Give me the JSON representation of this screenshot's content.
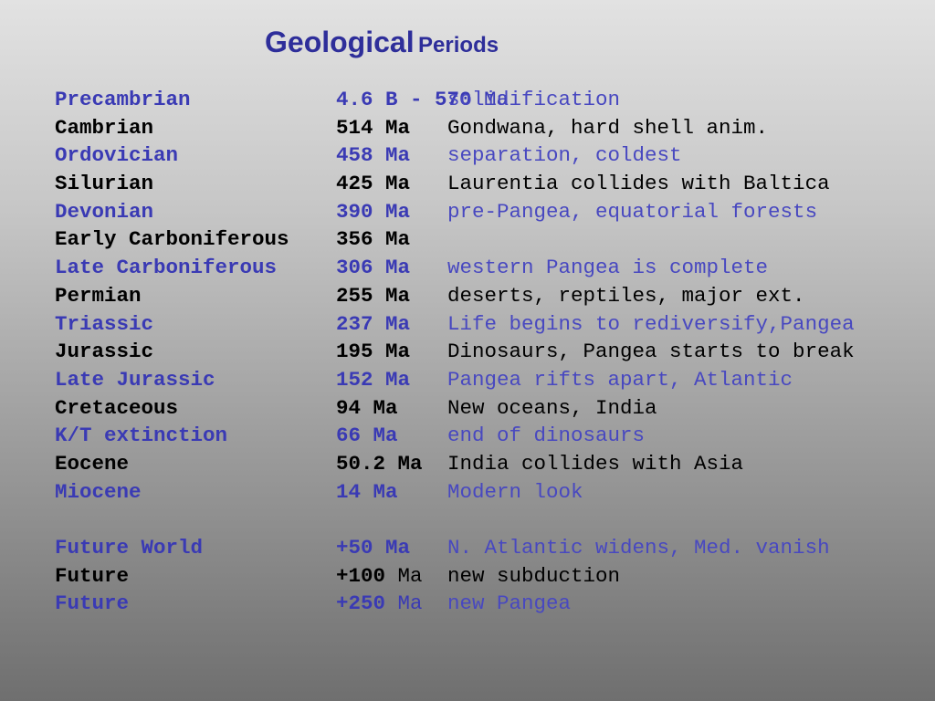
{
  "title": {
    "main": "Geological",
    "sub": "Periods"
  },
  "rows": [
    {
      "period": "Precambrian",
      "age_bold": "4.6 B - 570",
      "age_rest": " Ma",
      "desc": "solidification",
      "color": "blue"
    },
    {
      "period": "Cambrian",
      "age_bold": "514 Ma",
      "age_rest": "",
      "desc": "Gondwana, hard shell anim.",
      "color": "black"
    },
    {
      "period": "Ordovician",
      "age_bold": "458 Ma",
      "age_rest": "",
      "desc": "separation, coldest",
      "color": "blue"
    },
    {
      "period": "Silurian",
      "age_bold": "425 Ma",
      "age_rest": "",
      "desc": "Laurentia collides with Baltica",
      "color": "black"
    },
    {
      "period": "Devonian",
      "age_bold": "390 Ma",
      "age_rest": "",
      "desc": "pre-Pangea, equatorial forests",
      "color": "blue"
    },
    {
      "period": "Early Carboniferous",
      "age_bold": "356 Ma",
      "age_rest": "",
      "desc": "",
      "color": "black"
    },
    {
      "period": "Late Carboniferous",
      "age_bold": "306 Ma",
      "age_rest": "",
      "desc": "western Pangea is complete",
      "color": "blue"
    },
    {
      "period": "Permian",
      "age_bold": "255 Ma",
      "age_rest": "",
      "desc": "deserts, reptiles, major ext.",
      "color": "black"
    },
    {
      "period": "Triassic",
      "age_bold": "237 Ma",
      "age_rest": "",
      "desc": "Life begins to rediversify,Pangea",
      "color": "blue"
    },
    {
      "period": "Jurassic",
      "age_bold": "195 Ma",
      "age_rest": "",
      "desc": "Dinosaurs, Pangea starts to break",
      "color": "black"
    },
    {
      "period": "Late Jurassic",
      "age_bold": "152 Ma",
      "age_rest": "",
      "desc": "Pangea rifts apart, Atlantic",
      "color": "blue"
    },
    {
      "period": "Cretaceous",
      "age_bold": "94 Ma",
      "age_rest": "",
      "desc": "New oceans, India",
      "color": "black"
    },
    {
      "period": "K/T extinction",
      "age_bold": "66 Ma",
      "age_rest": "",
      "desc": "end of dinosaurs",
      "color": "blue"
    },
    {
      "period": "Eocene",
      "age_bold": "50.2 Ma",
      "age_rest": "",
      "desc": "India collides with Asia",
      "color": "black"
    },
    {
      "period": "Miocene",
      "age_bold": "14 Ma",
      "age_rest": "",
      "desc": "Modern look",
      "color": "blue"
    }
  ],
  "future_rows": [
    {
      "period": "Future World",
      "age_bold": "+50 Ma",
      "age_rest": "",
      "desc": "N. Atlantic widens, Med. vanish",
      "color": "blue"
    },
    {
      "period": "Future",
      "age_bold": "+100",
      "age_rest": " Ma",
      "desc": "new subduction",
      "color": "black"
    },
    {
      "period": "Future",
      "age_bold": "+250",
      "age_rest": " Ma",
      "desc": "new Pangea",
      "color": "blue"
    }
  ]
}
